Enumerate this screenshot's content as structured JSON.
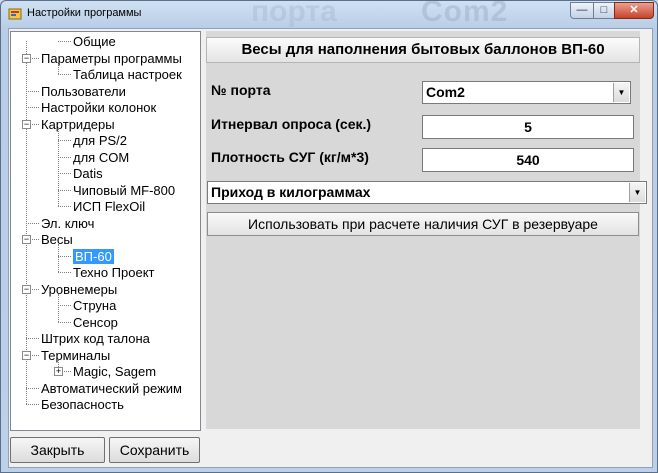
{
  "window": {
    "title": "Настройки программы",
    "background_text": "Com2",
    "background_text_2": "порта"
  },
  "tree": {
    "items": [
      {
        "label": "Общие",
        "level": 1
      },
      {
        "label": "Параметры программы",
        "level": 0,
        "expanded": true
      },
      {
        "label": "Таблица настроек",
        "level": 1
      },
      {
        "label": "Пользователи",
        "level": 0
      },
      {
        "label": "Настройки колонок",
        "level": 0
      },
      {
        "label": "Картридеры",
        "level": 0,
        "expanded": true
      },
      {
        "label": "для PS/2",
        "level": 1
      },
      {
        "label": "для COM",
        "level": 1
      },
      {
        "label": "Datis",
        "level": 1
      },
      {
        "label": "Чиповый MF-800",
        "level": 1
      },
      {
        "label": "ИСП FlexOil",
        "level": 1
      },
      {
        "label": "Эл. ключ",
        "level": 0
      },
      {
        "label": "Весы",
        "level": 0,
        "expanded": true
      },
      {
        "label": "ВП-60",
        "level": 1,
        "selected": true
      },
      {
        "label": "Техно Проект",
        "level": 1
      },
      {
        "label": "Уровнемеры",
        "level": 0,
        "expanded": true
      },
      {
        "label": "Струна",
        "level": 1
      },
      {
        "label": "Сенсор",
        "level": 1
      },
      {
        "label": "Штрих код талона",
        "level": 0
      },
      {
        "label": "Терминалы",
        "level": 0,
        "expanded": true
      },
      {
        "label": "Magic, Sagem",
        "level": 1,
        "collapsed": true
      },
      {
        "label": "Автоматический режим",
        "level": 0
      },
      {
        "label": "Безопасность",
        "level": 0
      }
    ]
  },
  "buttons": {
    "close": "Закрыть",
    "save": "Сохранить"
  },
  "panel": {
    "title": "Весы для наполнения бытовых баллонов  ВП-60",
    "port_label": "№ порта",
    "port_value": "Com2",
    "interval_label": "Итнервал опроса (сек.)",
    "interval_value": "5",
    "density_label": "Плотность СУГ (кг/м*3)",
    "density_value": "540",
    "mode_value": "Приход в килограммах",
    "use_button": "Использовать при расчете наличия СУГ в резервуаре"
  },
  "colors": {
    "selection": "#3399ff",
    "close_button": "#c8432a"
  }
}
